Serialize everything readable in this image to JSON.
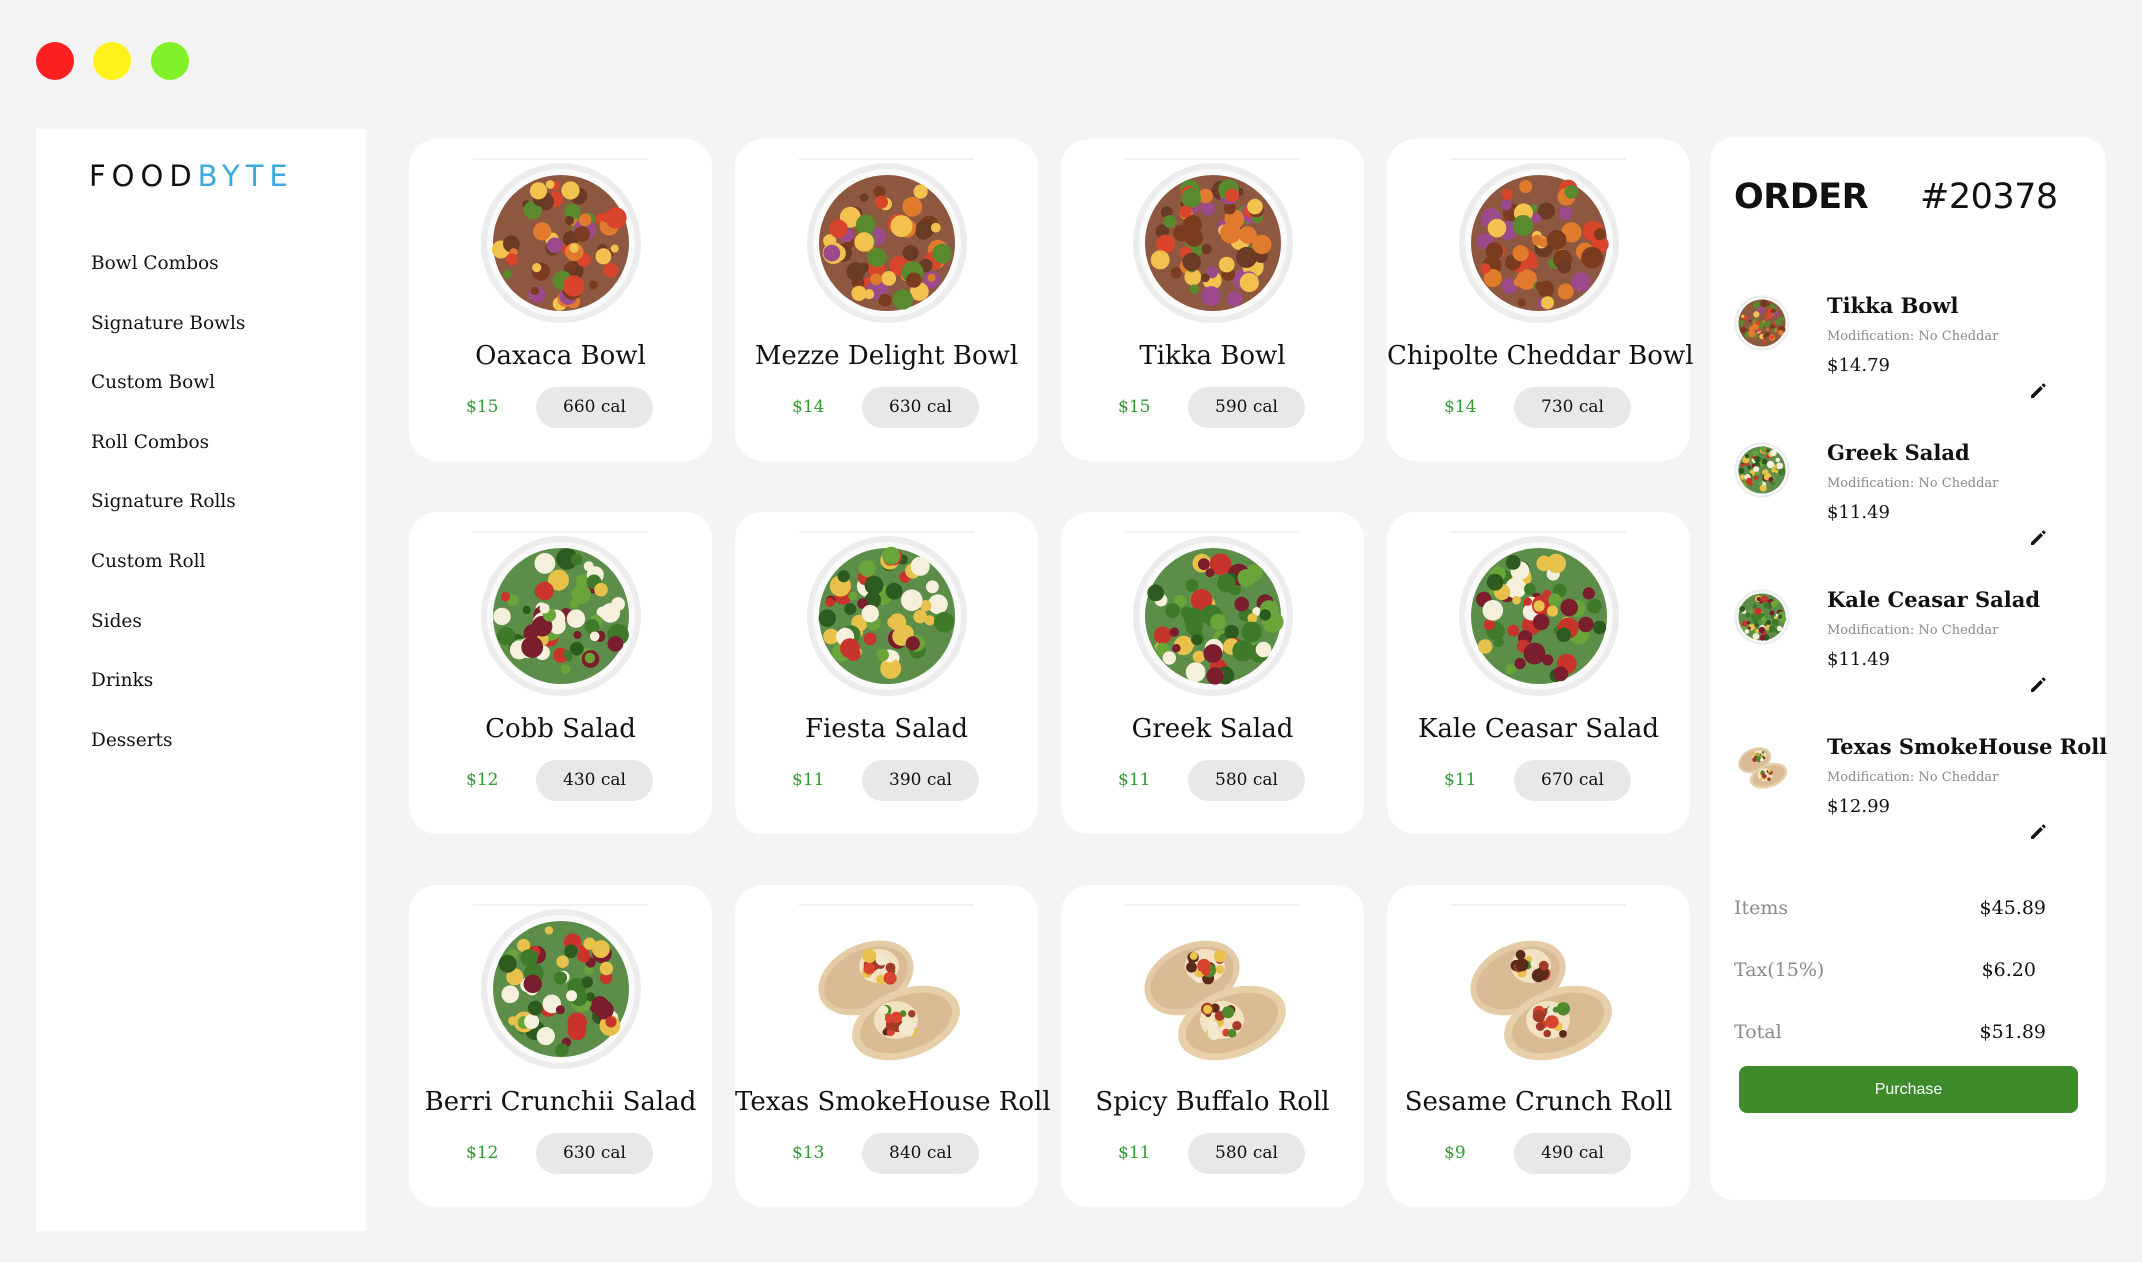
{
  "window": {
    "controls": [
      "close",
      "minimize",
      "maximize"
    ]
  },
  "brand": {
    "part1": "FOOD",
    "part2": "BYTE",
    "accent_color": "#3aa9e0"
  },
  "nav": [
    "Bowl Combos",
    "Signature Bowls",
    "Custom Bowl",
    "Roll Combos",
    "Signature Rolls",
    "Custom Roll",
    "Sides",
    "Drinks",
    "Desserts"
  ],
  "menu": [
    {
      "name": "Oaxaca Bowl",
      "price": "$15",
      "calories": "660 cal",
      "image": "bowl-image"
    },
    {
      "name": "Mezze Delight Bowl",
      "price": "$14",
      "calories": "630 cal",
      "image": "bowl-image"
    },
    {
      "name": "Tikka Bowl",
      "price": "$15",
      "calories": "590 cal",
      "image": "bowl-image"
    },
    {
      "name": "Chipolte Cheddar Bowl",
      "price": "$14",
      "calories": "730 cal",
      "image": "bowl-image"
    },
    {
      "name": "Cobb Salad",
      "price": "$12",
      "calories": "430 cal",
      "image": "salad-image"
    },
    {
      "name": "Fiesta Salad",
      "price": "$11",
      "calories": "390 cal",
      "image": "salad-image"
    },
    {
      "name": "Greek Salad",
      "price": "$11",
      "calories": "580 cal",
      "image": "salad-image"
    },
    {
      "name": "Kale Ceasar Salad",
      "price": "$11",
      "calories": "670 cal",
      "image": "salad-image"
    },
    {
      "name": "Berri Crunchii Salad",
      "price": "$12",
      "calories": "630 cal",
      "image": "salad-image"
    },
    {
      "name": "Texas SmokeHouse Roll",
      "price": "$13",
      "calories": "840 cal",
      "image": "wrap-image"
    },
    {
      "name": "Spicy Buffalo Roll",
      "price": "$11",
      "calories": "580 cal",
      "image": "wrap-image"
    },
    {
      "name": "Sesame Crunch Roll",
      "price": "$9",
      "calories": "490 cal",
      "image": "wrap-image"
    }
  ],
  "order": {
    "title": "ORDER",
    "number": "#20378",
    "items": [
      {
        "name": "Tikka Bowl",
        "modification": "Modification: No Cheddar",
        "price": "$14.79",
        "edit_icon": "pencil-icon"
      },
      {
        "name": "Greek Salad",
        "modification": "Modification: No Cheddar",
        "price": "$11.49",
        "edit_icon": "pencil-icon"
      },
      {
        "name": "Kale Ceasar Salad",
        "modification": "Modification: No Cheddar",
        "price": "$11.49",
        "edit_icon": "pencil-icon"
      },
      {
        "name": "Texas SmokeHouse Roll",
        "modification": "Modification: No Cheddar",
        "price": "$12.99",
        "edit_icon": "pencil-icon"
      }
    ],
    "summary": {
      "items_label": "Items",
      "items_value": "$45.89",
      "tax_label": "Tax(15%)",
      "tax_value": "$6.20",
      "total_label": "Total",
      "total_value": "$51.89"
    },
    "purchase_label": "Purchase",
    "purchase_color": "#3d8b2a"
  },
  "colors": {
    "price": "#2e9b2e",
    "background": "#f4f4f4"
  }
}
